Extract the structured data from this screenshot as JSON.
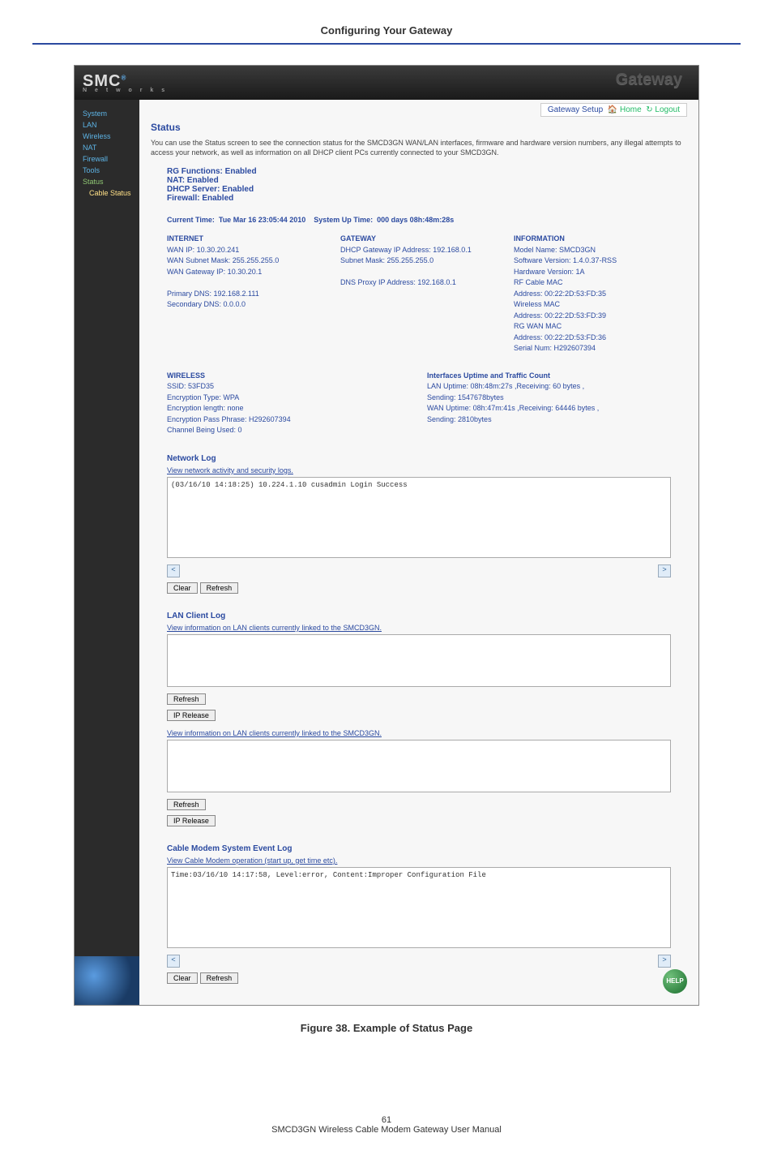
{
  "doc": {
    "header": "Configuring Your Gateway",
    "caption": "Figure 38. Example of Status Page",
    "page_number": "61",
    "manual_title": "SMCD3GN Wireless Cable Modem Gateway User Manual"
  },
  "brand": {
    "name": "SMC",
    "sub": "N e t w o r k s",
    "gateway": "Gateway"
  },
  "topbar": {
    "setup": "Gateway Setup",
    "home": "Home",
    "logout": "Logout"
  },
  "sidebar": {
    "items": [
      "System",
      "LAN",
      "Wireless",
      "NAT",
      "Firewall",
      "Tools",
      "Status"
    ],
    "sub": "Cable Status"
  },
  "status": {
    "title": "Status",
    "desc": "You can use the Status screen to see the connection status for the SMCD3GN WAN/LAN interfaces, firmware and hardware version numbers, any illegal attempts to access your network, as well as information on all DHCP client PCs currently connected to your SMCD3GN.",
    "rg": "RG Functions: Enabled",
    "nat": "NAT: Enabled",
    "dhcp": "DHCP Server: Enabled",
    "firewall": "Firewall: Enabled",
    "current_time_label": "Current Time:",
    "current_time_value": "Tue Mar 16 23:05:44 2010",
    "uptime_label": "System Up Time:",
    "uptime_value": "000 days 08h:48m:28s"
  },
  "internet": {
    "head": "INTERNET",
    "wan_ip": "WAN IP: 10.30.20.241",
    "subnet": "WAN Subnet Mask: 255.255.255.0",
    "gw": "WAN Gateway IP: 10.30.20.1",
    "pdns": "Primary DNS: 192.168.2.111",
    "sdns": "Secondary DNS: 0.0.0.0"
  },
  "gateway_col": {
    "head": "GATEWAY",
    "dhcp_gw": "DHCP Gateway IP Address: 192.168.0.1",
    "subnet": "Subnet Mask: 255.255.255.0",
    "dnsproxy": "DNS Proxy IP Address: 192.168.0.1"
  },
  "info": {
    "head": "INFORMATION",
    "model": "Model Name: SMCD3GN",
    "sw": "Software Version: 1.4.0.37-RSS",
    "hw": "Hardware Version: 1A",
    "rfmac_l": "RF Cable MAC",
    "rfmac": "Address: 00:22:2D:53:FD:35",
    "wmac_l": "Wireless MAC",
    "wmac": "Address: 00:22:2D:53:FD:39",
    "rgmac_l": "RG WAN MAC",
    "rgmac": "Address: 00:22:2D:53:FD:36",
    "serial": "Serial Num: H292607394"
  },
  "wireless": {
    "head": "WIRELESS",
    "ssid": "SSID: 53FD35",
    "enc": "Encryption Type: WPA",
    "len": "Encryption length: none",
    "pass": "Encryption Pass Phrase: H292607394",
    "chan": "Channel Being Used: 0"
  },
  "traffic": {
    "head": "Interfaces Uptime and Traffic Count",
    "lan": "LAN Uptime: 08h:48m:27s ,Receiving: 60 bytes ,",
    "send": "Sending: 1547678bytes",
    "wan": "WAN Uptime: 08h:47m:41s ,Receiving: 64446 bytes ,",
    "wsend": "Sending: 2810bytes"
  },
  "netlog": {
    "title": "Network Log",
    "link": "View network activity and security logs.",
    "content": "(03/16/10 14:18:25) 10.224.1.10 cusadmin Login Success"
  },
  "lanlog": {
    "title": "LAN Client Log",
    "link": "View information on LAN clients currently linked to the SMCD3GN."
  },
  "lanlog2": {
    "link": "View information on LAN clients currently linked to the SMCD3GN."
  },
  "cablelog": {
    "title": "Cable Modem System Event Log",
    "link": "View Cable Modem operation (start up, get time etc).",
    "content": "Time:03/16/10 14:17:58, Level:error, Content:Improper Configuration File"
  },
  "buttons": {
    "clear": "Clear",
    "refresh": "Refresh",
    "iprelease": "IP Release"
  },
  "help": "HELP"
}
